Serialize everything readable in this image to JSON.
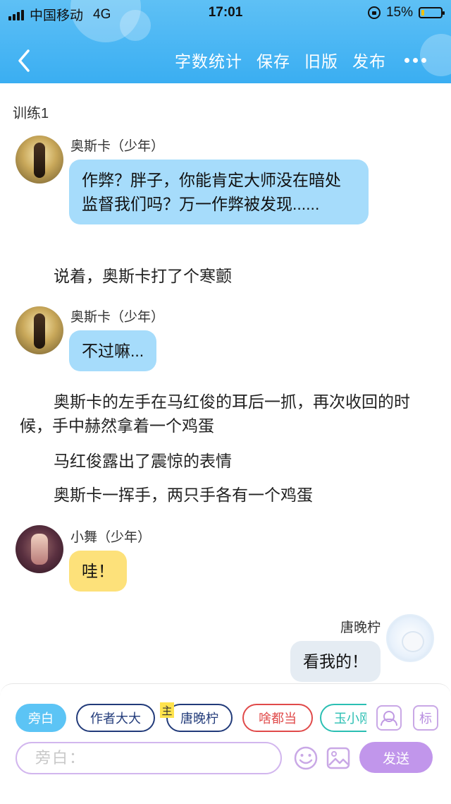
{
  "status_bar": {
    "carrier": "中国移动",
    "network": "4G",
    "time": "17:01",
    "battery_percent": "15%",
    "battery_level": 0.15
  },
  "nav": {
    "back_icon": "chevron-left-icon",
    "actions": [
      "字数统计",
      "保存",
      "旧版",
      "发布"
    ],
    "more_icon": "ellipsis-icon"
  },
  "colors": {
    "header": "#3aaef2",
    "bubble_blue": "#a6dcfb",
    "bubble_yellow": "#fde17a",
    "bubble_gray": "#e5ecf3",
    "send_button": "#c196eb"
  },
  "chapter_title": "训练1",
  "messages": [
    {
      "type": "dialog",
      "side": "left",
      "speaker": "奥斯卡（少年）",
      "text": "作弊？胖子，你能肯定大师没在暗处监督我们吗？万一作弊被发现......"
    },
    {
      "type": "narration",
      "text": "说着，奥斯卡打了个寒颤"
    },
    {
      "type": "dialog",
      "side": "left",
      "speaker": "奥斯卡（少年）",
      "text": "不过嘛..."
    },
    {
      "type": "narration",
      "text": "奥斯卡的左手在马红俊的耳后一抓，再次收回的时候，手中赫然拿着一个鸡蛋"
    },
    {
      "type": "narration",
      "text": "马红俊露出了震惊的表情"
    },
    {
      "type": "narration",
      "text": "奥斯卡一挥手，两只手各有一个鸡蛋"
    },
    {
      "type": "dialog",
      "side": "left",
      "speaker": "小舞（少年）",
      "text": "哇！"
    },
    {
      "type": "dialog",
      "side": "right",
      "speaker": "唐晚柠",
      "text": "看我的！"
    }
  ],
  "composer": {
    "roles": [
      "旁白",
      "作者大大",
      "唐晚柠",
      "啥都当",
      "玉小刚"
    ],
    "main_badge": "主",
    "role_icon": "person-card-icon",
    "tag_label": "标",
    "placeholder": "旁白：",
    "emoji_icon": "smiley-icon",
    "image_icon": "image-icon",
    "send_label": "发送"
  }
}
